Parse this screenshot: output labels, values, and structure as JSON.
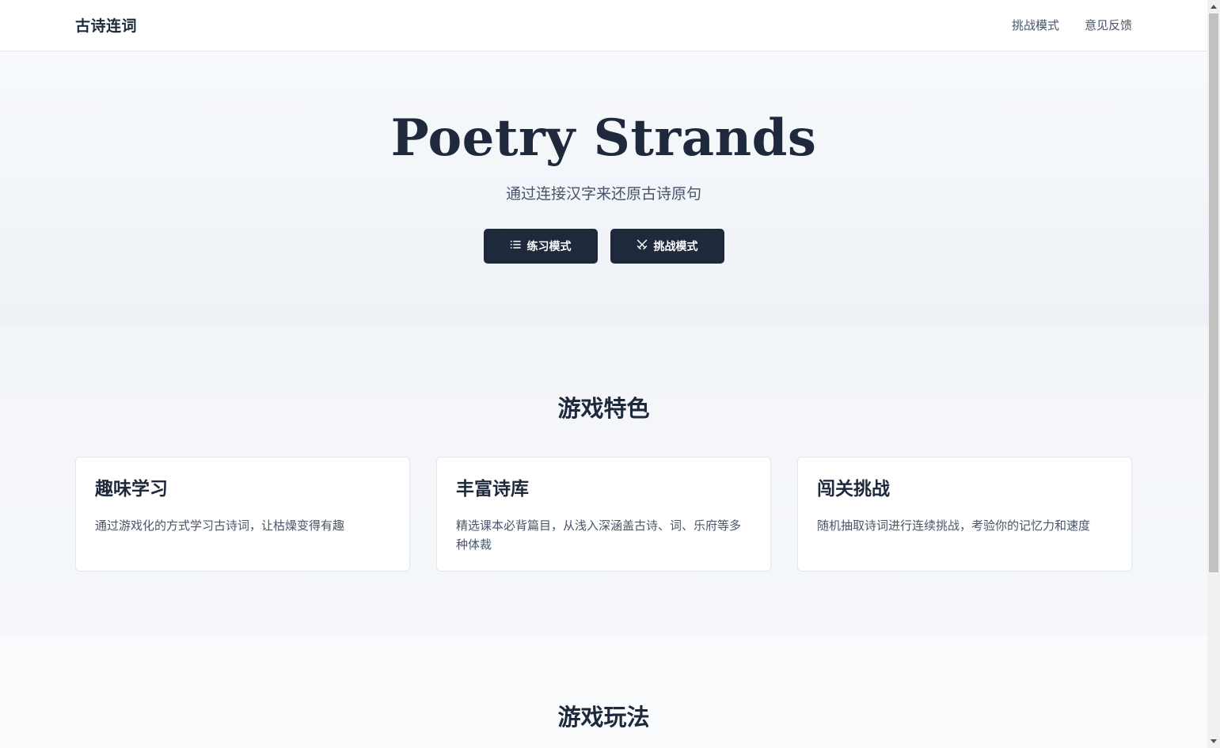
{
  "header": {
    "brand": "古诗连词",
    "nav": [
      {
        "label": "挑战模式"
      },
      {
        "label": "意见反馈"
      }
    ]
  },
  "hero": {
    "title": "Poetry Strands",
    "subtitle": "通过连接汉字来还原古诗原句",
    "buttons": {
      "practice": {
        "label": "练习模式",
        "icon": "list-icon"
      },
      "challenge": {
        "label": "挑战模式",
        "icon": "swords-icon"
      }
    }
  },
  "features": {
    "title": "游戏特色",
    "cards": [
      {
        "title": "趣味学习",
        "desc": "通过游戏化的方式学习古诗词，让枯燥变得有趣"
      },
      {
        "title": "丰富诗库",
        "desc": "精选课本必背篇目，从浅入深涵盖古诗、词、乐府等多种体裁"
      },
      {
        "title": "闯关挑战",
        "desc": "随机抽取诗词进行连续挑战，考验你的记忆力和速度"
      }
    ]
  },
  "gameplay": {
    "title": "游戏玩法"
  },
  "colors": {
    "primary": "#1e293b",
    "muted_text": "#475569",
    "border": "#e2e8f0"
  }
}
